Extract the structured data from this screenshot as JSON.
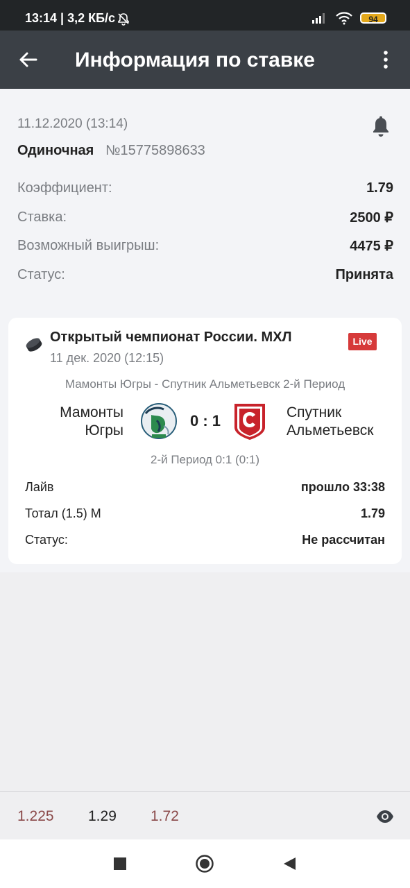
{
  "status_bar": {
    "time": "13:14 | 3,2 КБ/с",
    "battery": "94",
    "icons": [
      "mute-icon",
      "signal-icon",
      "wifi-icon",
      "battery-icon"
    ]
  },
  "app_bar": {
    "title": "Информация по ставке",
    "back_icon": "arrow-left-icon",
    "menu_icon": "more-vertical-icon"
  },
  "bet": {
    "date": "11.12.2020 (13:14)",
    "type": "Одиночная",
    "number": "№15775898633",
    "rows": [
      {
        "label": "Коэффициент:",
        "value": "1.79"
      },
      {
        "label": "Ставка:",
        "value": "2500 ₽"
      },
      {
        "label": "Возможный выигрыш:",
        "value": "4475 ₽"
      },
      {
        "label": "Статус:",
        "value": "Принята"
      }
    ]
  },
  "event": {
    "tournament": "Открытый чемпионат России. МХЛ",
    "date": "11 дек. 2020 (12:15)",
    "live_badge": "Live",
    "match_info": "Мамонты Югры - Спутник Альметьевск 2-й Период",
    "team_home_line1": "Мамонты",
    "team_home_line2": "Югры",
    "team_away_line1": "Спутник",
    "team_away_line2": "Альметьевск",
    "score": "0 : 1",
    "period_score": "2-й Период 0:1 (0:1)",
    "rows": [
      {
        "label": "Лайв",
        "value": "прошло 33:38"
      },
      {
        "label": "Тотал (1.5) М",
        "value": "1.79"
      },
      {
        "label": "Статус:",
        "value": "Не рассчитан"
      }
    ]
  },
  "odds_bar": {
    "odds": [
      "1.225",
      "1.29",
      "1.72"
    ],
    "colors": [
      "#8b4a4a",
      "#222222",
      "#8b4a4a"
    ]
  },
  "colors": {
    "app_bar": "#3b4046",
    "status_bar": "#222527",
    "live_badge": "#d63a3a",
    "battery": "#e3a81b"
  }
}
